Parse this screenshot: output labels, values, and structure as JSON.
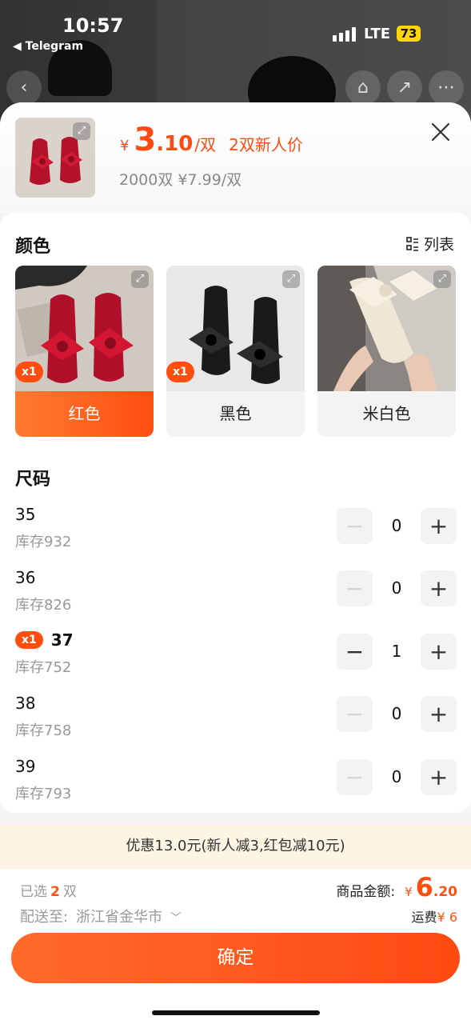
{
  "status_bar": {
    "time": "10:57",
    "back_app": "◀ Telegram",
    "network": "LTE",
    "battery": "73"
  },
  "product": {
    "price_symbol": "¥",
    "price_int": "3",
    "price_dec": ".10",
    "price_unit": "/双",
    "price_tag": "2双新人价",
    "bulk_price": "2000双 ¥7.99/双"
  },
  "colors": {
    "title": "颜色",
    "list_toggle_label": "列表",
    "options": [
      {
        "label": "红色",
        "badge": "x1",
        "selected": true
      },
      {
        "label": "黑色",
        "badge": "x1",
        "selected": false
      },
      {
        "label": "米白色",
        "badge": "",
        "selected": false
      }
    ]
  },
  "sizes": {
    "title": "尺码",
    "rows": [
      {
        "size": "35",
        "stock": "库存932",
        "qty": "0",
        "badge": ""
      },
      {
        "size": "36",
        "stock": "库存826",
        "qty": "0",
        "badge": ""
      },
      {
        "size": "37",
        "stock": "库存752",
        "qty": "1",
        "badge": "x1"
      },
      {
        "size": "38",
        "stock": "库存758",
        "qty": "0",
        "badge": ""
      },
      {
        "size": "39",
        "stock": "库存793",
        "qty": "0",
        "badge": ""
      }
    ],
    "minus": "−",
    "plus": "+"
  },
  "promo_text": "优惠13.0元(新人减3,红包减10元)",
  "footer": {
    "selected_prefix": "已选",
    "selected_count": "2",
    "selected_suffix": "双",
    "ship_label": "配送至:",
    "ship_location": "浙江省金华市",
    "amount_label": "商品金额:",
    "amount_symbol": "¥",
    "amount_int": "6",
    "amount_dec": ".20",
    "freight_label": "运费",
    "freight_value": "¥ 6",
    "confirm_label": "确定"
  },
  "accent_color": "#ff4e10"
}
